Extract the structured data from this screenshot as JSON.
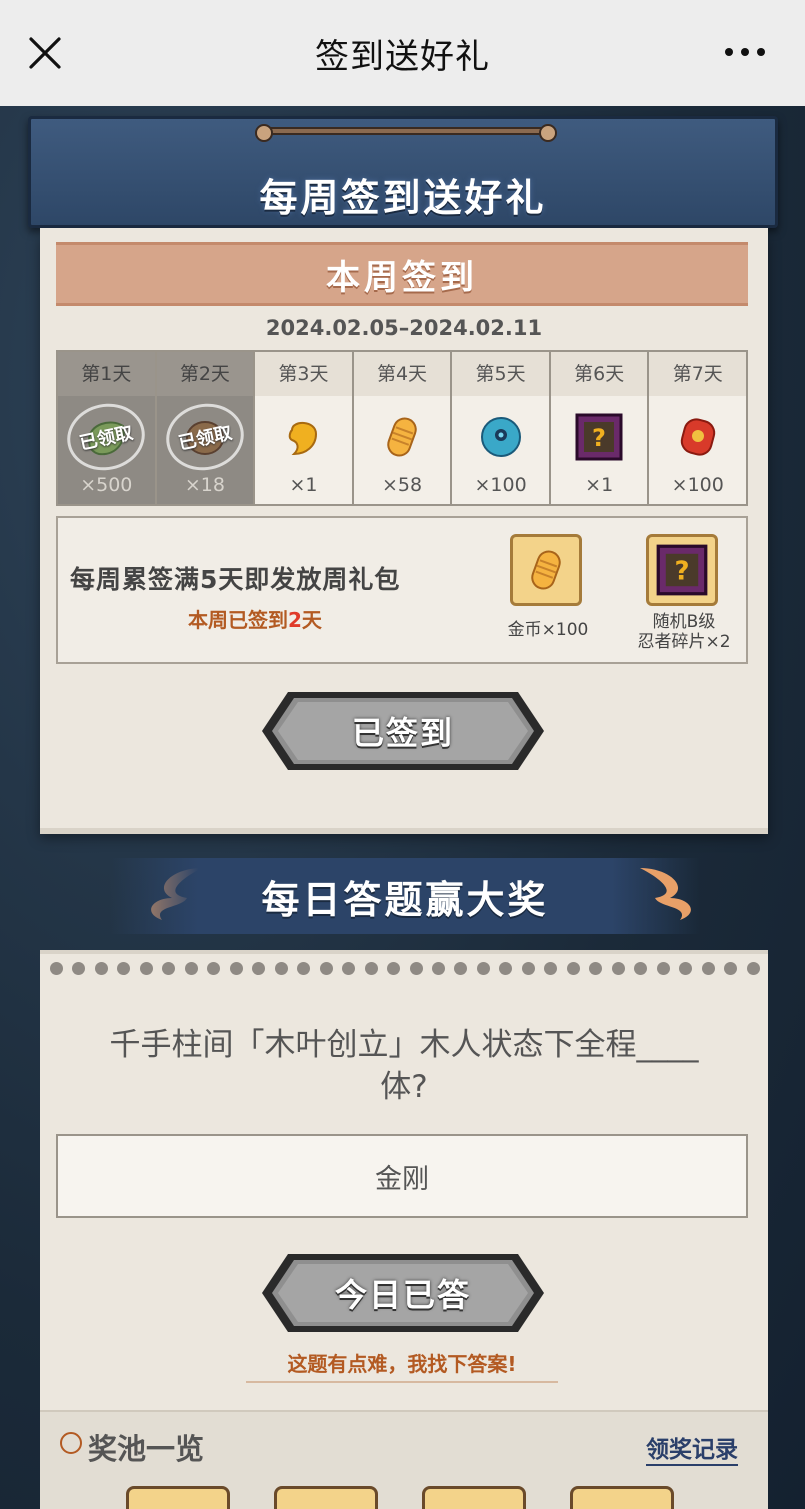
{
  "topbar": {
    "title": "签到送好礼"
  },
  "week_banner": {
    "title": "每周签到送好礼"
  },
  "checkin": {
    "title": "本周签到",
    "date_range": "2024.02.05–2024.02.11",
    "claimed_stamp": "已领取",
    "days": [
      {
        "label": "第1天",
        "qty": "×500",
        "icon": "green-leaf-icon",
        "claimed": true
      },
      {
        "label": "第2天",
        "qty": "×18",
        "icon": "brown-item-icon",
        "claimed": true
      },
      {
        "label": "第3天",
        "qty": "×1",
        "icon": "gold-drop-icon",
        "claimed": false
      },
      {
        "label": "第4天",
        "qty": "×58",
        "icon": "gold-coin-icon",
        "claimed": false
      },
      {
        "label": "第5天",
        "qty": "×100",
        "icon": "blue-orb-icon",
        "claimed": false
      },
      {
        "label": "第6天",
        "qty": "×1",
        "icon": "mystery-shard-icon",
        "claimed": false
      },
      {
        "label": "第7天",
        "qty": "×100",
        "icon": "red-scroll-icon",
        "claimed": false
      }
    ],
    "bonus": {
      "text": "每周累签满5天即发放周礼包",
      "progress_prefix": "本周已签到",
      "progress_num": "2",
      "progress_suffix": "天",
      "rewards": [
        {
          "caption": "金币×100",
          "icon": "gold-coin-icon"
        },
        {
          "caption_line1": "随机B级",
          "caption_line2": "忍者碎片×2",
          "icon": "mystery-shard-icon"
        }
      ]
    },
    "button": "已签到"
  },
  "quiz": {
    "title": "每日答题赢大奖",
    "question_line1": "千手柱间「木叶创立」木人状态下全程____",
    "question_line2": "体?",
    "answer": "金刚",
    "button": "今日已答",
    "hint": "这题有点难，我找下答案!",
    "pool_title": "奖池一览",
    "records_link": "领奖记录"
  }
}
